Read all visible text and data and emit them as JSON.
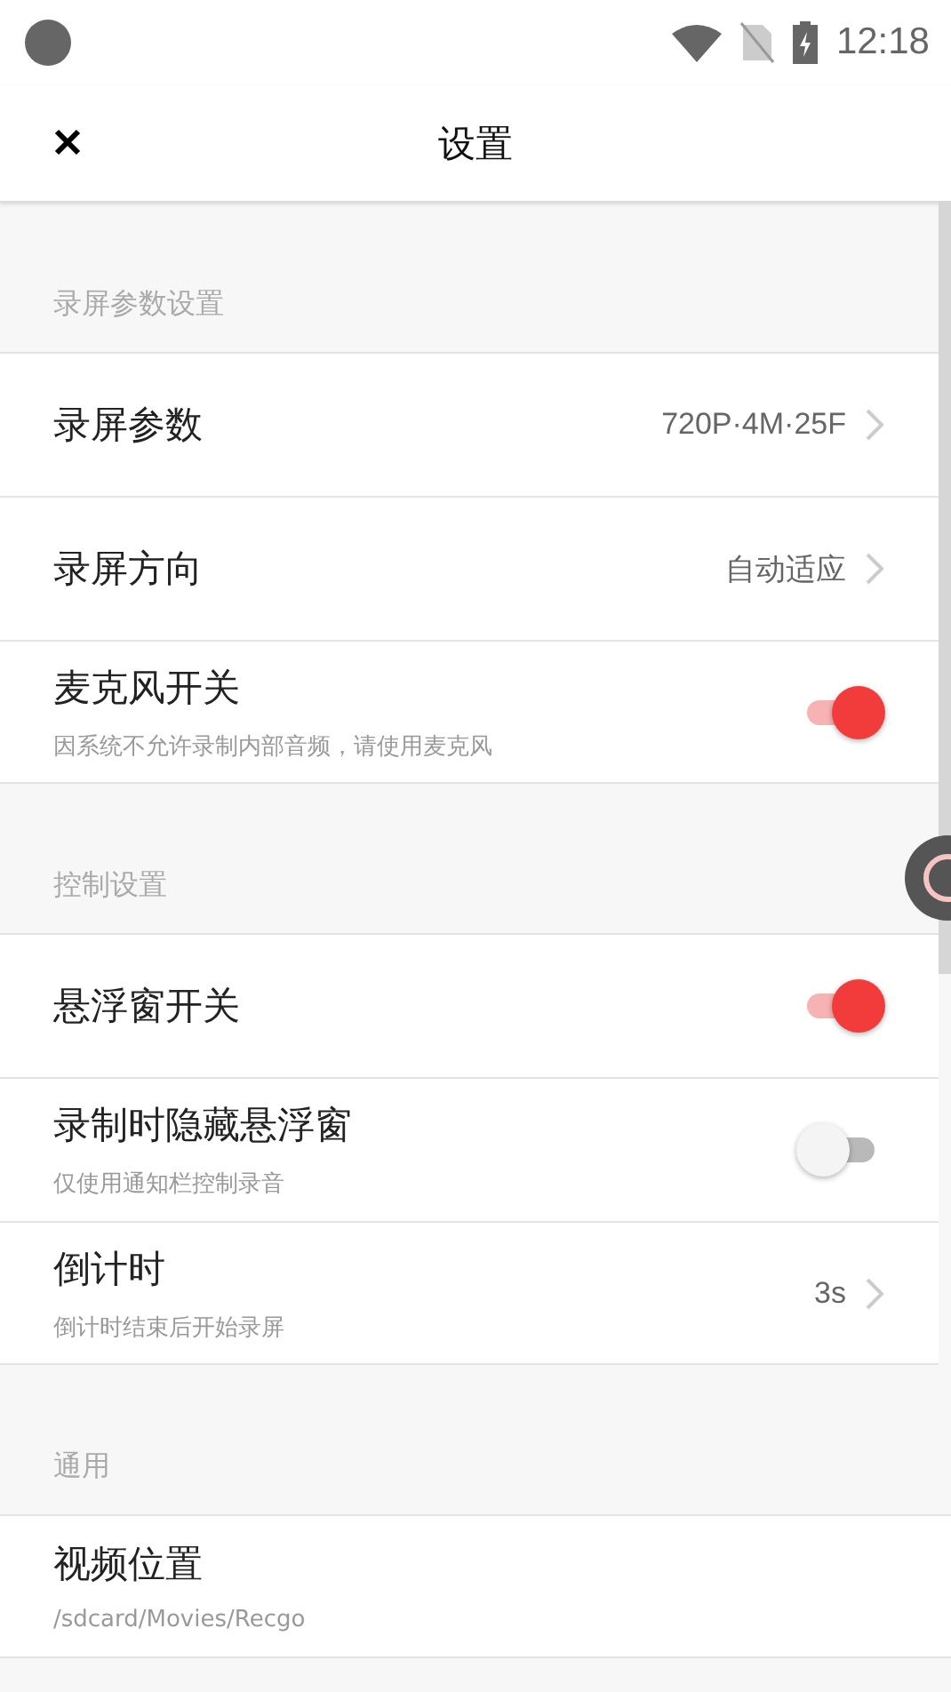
{
  "status_bar": {
    "time": "12:18"
  },
  "app_bar": {
    "title": "设置"
  },
  "sections": [
    {
      "title": "录屏参数设置",
      "items": [
        {
          "kind": "value",
          "label": "录屏参数",
          "value": "720P·4M·25F"
        },
        {
          "kind": "value",
          "label": "录屏方向",
          "value": "自动适应"
        },
        {
          "kind": "toggle",
          "label": "麦克风开关",
          "subtitle": "因系统不允许录制内部音频，请使用麦克风",
          "on": true
        }
      ]
    },
    {
      "title": "控制设置",
      "items": [
        {
          "kind": "toggle",
          "label": "悬浮窗开关",
          "on": true
        },
        {
          "kind": "toggle",
          "label": "录制时隐藏悬浮窗",
          "subtitle": "仅使用通知栏控制录音",
          "on": false
        },
        {
          "kind": "value",
          "label": "倒计时",
          "subtitle": "倒计时结束后开始录屏",
          "value": "3s"
        }
      ]
    },
    {
      "title": "通用",
      "items": [
        {
          "kind": "plain",
          "label": "视频位置",
          "subtitle": "/sdcard/Movies/Recgo"
        }
      ]
    }
  ]
}
